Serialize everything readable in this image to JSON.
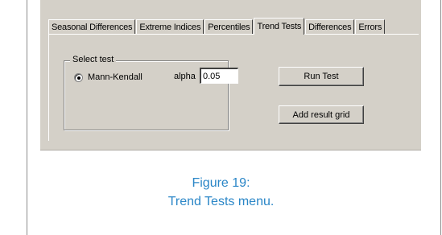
{
  "tabs": [
    {
      "label": "Seasonal Differences",
      "active": false
    },
    {
      "label": "Extreme Indices",
      "active": false
    },
    {
      "label": "Percentiles",
      "active": false
    },
    {
      "label": "Trend Tests",
      "active": true
    },
    {
      "label": "Differences",
      "active": false
    },
    {
      "label": "Errors",
      "active": false
    }
  ],
  "select_test": {
    "legend": "Select test",
    "option_label": "Mann-Kendall",
    "selected": true
  },
  "alpha": {
    "label": "alpha",
    "value": "0.05"
  },
  "buttons": {
    "run_test": "Run Test",
    "add_result_grid": "Add result grid"
  },
  "caption": {
    "line1": "Figure 19:",
    "line2": "Trend Tests menu."
  },
  "colors": {
    "window_bg": "#d4d0c8",
    "caption": "#2a86c7"
  }
}
